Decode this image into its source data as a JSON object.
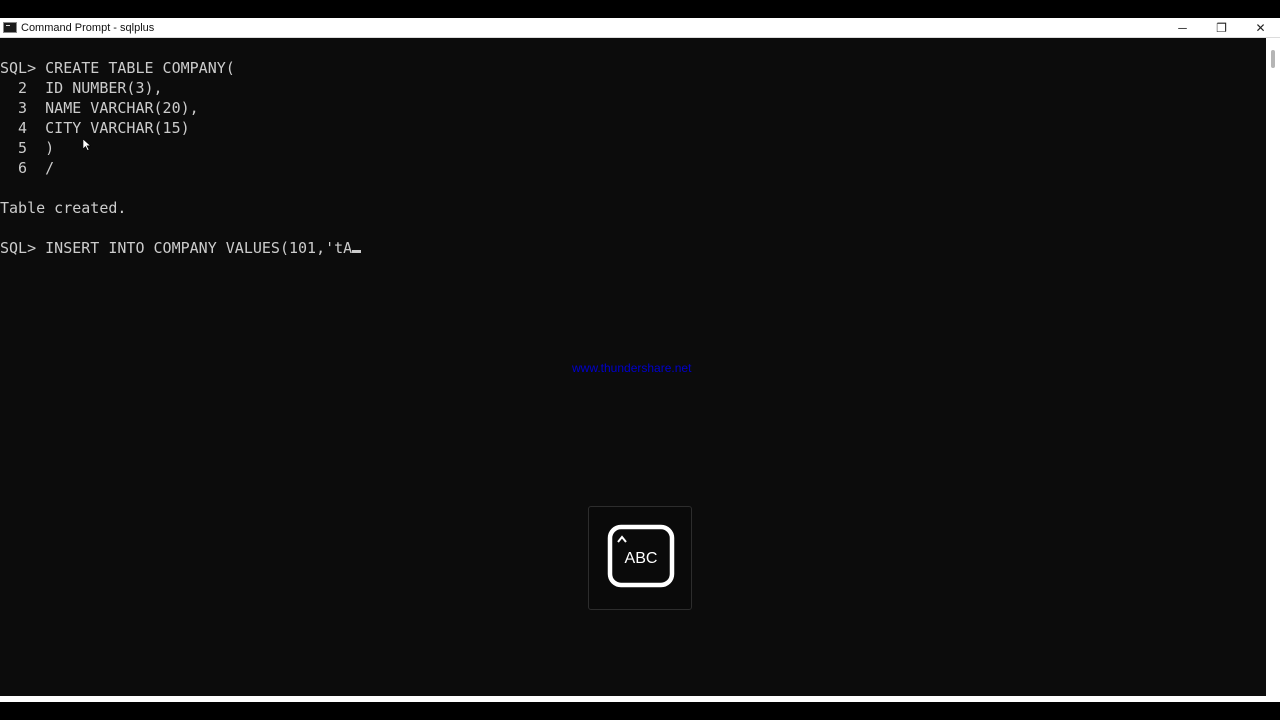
{
  "window": {
    "title": "Command Prompt - sqlplus",
    "controls": {
      "minimize": "─",
      "restore": "❐",
      "close": "✕"
    }
  },
  "console": {
    "lines": [
      "SQL> CREATE TABLE COMPANY(",
      "  2  ID NUMBER(3),",
      "  3  NAME VARCHAR(20),",
      "  4  CITY VARCHAR(15)",
      "  5  )",
      "  6  /",
      "",
      "Table created.",
      "",
      "SQL> INSERT INTO COMPANY VALUES(101,'tA"
    ]
  },
  "watermark": "www.thundershare.net",
  "key_overlay": {
    "label": "ABC",
    "icon": "keyboard-input-icon"
  },
  "colors": {
    "console_bg": "#0c0c0c",
    "console_text": "#cccccc",
    "watermark": "#0000cc"
  }
}
